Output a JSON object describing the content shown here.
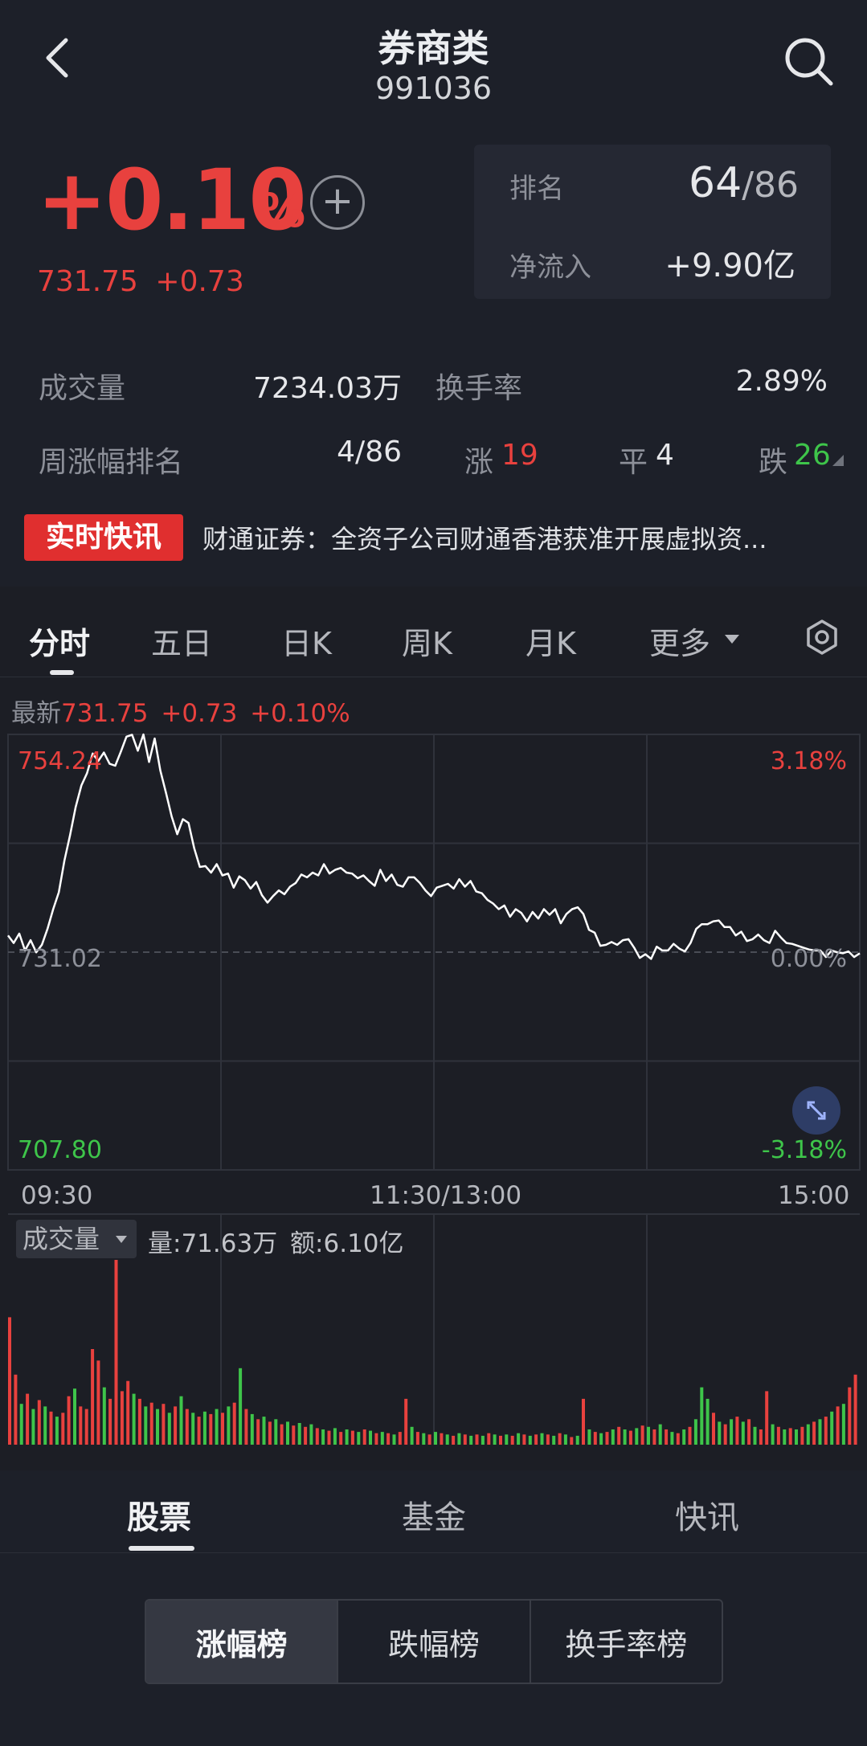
{
  "header": {
    "title": "券商类",
    "code": "991036"
  },
  "quote": {
    "change_pct": "+0.10",
    "pct_unit": "%",
    "add_symbol": "+",
    "price": "731.75",
    "change": "+0.73"
  },
  "rank": {
    "label": "排名",
    "value": "64",
    "total": "/86",
    "inflow_label": "净流入",
    "inflow_value": "+9.90亿"
  },
  "stats": {
    "volume_label": "成交量",
    "volume_value": "7234.03万",
    "turnover_label": "换手率",
    "turnover_value": "2.89%",
    "week_rank_label": "周涨幅排名",
    "week_rank_value": "4/86",
    "up_label": "涨",
    "up_count": "19",
    "flat_label": "平",
    "flat_count": "4",
    "down_label": "跌",
    "down_count": "26"
  },
  "news": {
    "badge": "实时快讯",
    "text": "财通证券：全资子公司财通香港获准开展虚拟资..."
  },
  "chart_tabs": [
    "分时",
    "五日",
    "日K",
    "周K",
    "月K",
    "更多"
  ],
  "latest": {
    "label": "最新",
    "price": "731.75",
    "change": "+0.73",
    "pct": "+0.10%"
  },
  "chart_data": {
    "type": "line",
    "title": "",
    "x_ticks": [
      "09:30",
      "11:30/13:00",
      "15:00"
    ],
    "y_left_labels": {
      "high": "754.24",
      "base": "731.02",
      "low": "707.80"
    },
    "y_right_labels": {
      "high": "3.18%",
      "base": "0.00%",
      "low": "-3.18%"
    },
    "ylim": [
      707.8,
      754.24
    ],
    "baseline": 731.02,
    "series": [
      {
        "values": [
          732.8,
          732.0,
          733.0,
          731.2,
          732.3,
          731.0,
          731.8,
          733.5,
          735.6,
          737.4,
          740.8,
          743.5,
          746.5,
          748.8,
          750.1,
          752.2,
          751.4,
          752.3,
          751.1,
          750.9,
          752.4,
          754.0,
          754.2,
          752.5,
          754.24,
          751.3,
          753.8,
          750.4,
          748.0,
          745.5,
          743.6,
          745.2,
          744.8,
          742.1,
          740.1,
          740.2,
          739.5,
          740.4,
          739.2,
          739.4,
          737.9,
          739.1,
          738.7,
          737.8,
          738.5,
          737.1,
          736.3,
          737.0,
          737.6,
          737.2,
          738.0,
          738.4,
          739.3,
          739.0,
          739.5,
          739.2,
          740.4,
          739.4,
          739.8,
          740.0,
          739.5,
          739.4,
          738.9,
          739.2,
          738.6,
          738.1,
          739.8,
          738.6,
          739.3,
          738.2,
          738.0,
          739.0,
          739.0,
          738.4,
          737.6,
          737.0,
          737.9,
          738.1,
          738.3,
          737.8,
          738.8,
          738.0,
          738.6,
          737.5,
          737.3,
          736.6,
          736.2,
          735.6,
          736.0,
          734.8,
          735.6,
          735.2,
          734.3,
          735.3,
          734.6,
          735.6,
          735.0,
          735.6,
          734.1,
          735.1,
          735.6,
          735.8,
          735.1,
          733.4,
          733.1,
          731.7,
          731.8,
          732.1,
          731.8,
          732.3,
          732.4,
          731.5,
          730.4,
          730.8,
          730.3,
          731.6,
          731.2,
          731.2,
          731.9,
          731.4,
          731.1,
          732.0,
          733.5,
          734.0,
          734.0,
          734.3,
          734.4,
          733.7,
          733.7,
          732.8,
          733.2,
          732.2,
          732.4,
          732.9,
          732.3,
          732.0,
          733.3,
          732.6,
          732.0,
          731.9,
          731.7,
          731.5,
          731.3,
          731.2,
          731.2,
          730.5,
          731.2,
          731.0,
          730.9,
          731.1,
          730.5,
          730.9
        ]
      }
    ],
    "volume": {
      "label": "成交量",
      "info": "量:71.63万 额:6.10亿",
      "up_color": "#e8413e",
      "down_color": "#3ec54a",
      "bars": [
        {
          "v": 100,
          "u": 1
        },
        {
          "v": 55,
          "u": 1
        },
        {
          "v": 32,
          "u": 0
        },
        {
          "v": 40,
          "u": 1
        },
        {
          "v": 28,
          "u": 0
        },
        {
          "v": 35,
          "u": 1
        },
        {
          "v": 30,
          "u": 0
        },
        {
          "v": 26,
          "u": 1
        },
        {
          "v": 22,
          "u": 0
        },
        {
          "v": 25,
          "u": 1
        },
        {
          "v": 38,
          "u": 1
        },
        {
          "v": 44,
          "u": 0
        },
        {
          "v": 30,
          "u": 1
        },
        {
          "v": 28,
          "u": 1
        },
        {
          "v": 75,
          "u": 1
        },
        {
          "v": 66,
          "u": 1
        },
        {
          "v": 45,
          "u": 0
        },
        {
          "v": 36,
          "u": 1
        },
        {
          "v": 145,
          "u": 1
        },
        {
          "v": 42,
          "u": 1
        },
        {
          "v": 50,
          "u": 1
        },
        {
          "v": 40,
          "u": 0
        },
        {
          "v": 36,
          "u": 1
        },
        {
          "v": 30,
          "u": 0
        },
        {
          "v": 33,
          "u": 1
        },
        {
          "v": 28,
          "u": 0
        },
        {
          "v": 32,
          "u": 1
        },
        {
          "v": 25,
          "u": 0
        },
        {
          "v": 30,
          "u": 1
        },
        {
          "v": 38,
          "u": 0
        },
        {
          "v": 28,
          "u": 1
        },
        {
          "v": 25,
          "u": 0
        },
        {
          "v": 22,
          "u": 1
        },
        {
          "v": 26,
          "u": 0
        },
        {
          "v": 24,
          "u": 1
        },
        {
          "v": 28,
          "u": 0
        },
        {
          "v": 25,
          "u": 1
        },
        {
          "v": 30,
          "u": 0
        },
        {
          "v": 33,
          "u": 1
        },
        {
          "v": 60,
          "u": 0
        },
        {
          "v": 28,
          "u": 1
        },
        {
          "v": 24,
          "u": 0
        },
        {
          "v": 20,
          "u": 1
        },
        {
          "v": 22,
          "u": 0
        },
        {
          "v": 18,
          "u": 1
        },
        {
          "v": 20,
          "u": 0
        },
        {
          "v": 16,
          "u": 1
        },
        {
          "v": 18,
          "u": 0
        },
        {
          "v": 15,
          "u": 1
        },
        {
          "v": 17,
          "u": 0
        },
        {
          "v": 14,
          "u": 1
        },
        {
          "v": 16,
          "u": 0
        },
        {
          "v": 13,
          "u": 1
        },
        {
          "v": 12,
          "u": 0
        },
        {
          "v": 11,
          "u": 1
        },
        {
          "v": 13,
          "u": 0
        },
        {
          "v": 10,
          "u": 1
        },
        {
          "v": 12,
          "u": 0
        },
        {
          "v": 11,
          "u": 1
        },
        {
          "v": 10,
          "u": 0
        },
        {
          "v": 12,
          "u": 1
        },
        {
          "v": 11,
          "u": 0
        },
        {
          "v": 9,
          "u": 1
        },
        {
          "v": 10,
          "u": 0
        },
        {
          "v": 9,
          "u": 1
        },
        {
          "v": 8,
          "u": 0
        },
        {
          "v": 10,
          "u": 1
        },
        {
          "v": 36,
          "u": 1
        },
        {
          "v": 14,
          "u": 0
        },
        {
          "v": 10,
          "u": 1
        },
        {
          "v": 9,
          "u": 0
        },
        {
          "v": 8,
          "u": 1
        },
        {
          "v": 10,
          "u": 0
        },
        {
          "v": 9,
          "u": 1
        },
        {
          "v": 8,
          "u": 0
        },
        {
          "v": 7,
          "u": 1
        },
        {
          "v": 9,
          "u": 0
        },
        {
          "v": 8,
          "u": 1
        },
        {
          "v": 7,
          "u": 0
        },
        {
          "v": 8,
          "u": 1
        },
        {
          "v": 7,
          "u": 0
        },
        {
          "v": 9,
          "u": 1
        },
        {
          "v": 8,
          "u": 0
        },
        {
          "v": 7,
          "u": 1
        },
        {
          "v": 8,
          "u": 0
        },
        {
          "v": 7,
          "u": 1
        },
        {
          "v": 9,
          "u": 0
        },
        {
          "v": 8,
          "u": 1
        },
        {
          "v": 7,
          "u": 0
        },
        {
          "v": 8,
          "u": 1
        },
        {
          "v": 9,
          "u": 0
        },
        {
          "v": 8,
          "u": 1
        },
        {
          "v": 7,
          "u": 0
        },
        {
          "v": 9,
          "u": 1
        },
        {
          "v": 8,
          "u": 0
        },
        {
          "v": 6,
          "u": 1
        },
        {
          "v": 7,
          "u": 0
        },
        {
          "v": 36,
          "u": 1
        },
        {
          "v": 12,
          "u": 0
        },
        {
          "v": 10,
          "u": 1
        },
        {
          "v": 9,
          "u": 0
        },
        {
          "v": 10,
          "u": 1
        },
        {
          "v": 12,
          "u": 0
        },
        {
          "v": 14,
          "u": 1
        },
        {
          "v": 12,
          "u": 0
        },
        {
          "v": 11,
          "u": 1
        },
        {
          "v": 13,
          "u": 0
        },
        {
          "v": 15,
          "u": 1
        },
        {
          "v": 14,
          "u": 0
        },
        {
          "v": 12,
          "u": 1
        },
        {
          "v": 16,
          "u": 0
        },
        {
          "v": 12,
          "u": 1
        },
        {
          "v": 10,
          "u": 0
        },
        {
          "v": 9,
          "u": 1
        },
        {
          "v": 12,
          "u": 0
        },
        {
          "v": 14,
          "u": 1
        },
        {
          "v": 20,
          "u": 0
        },
        {
          "v": 45,
          "u": 0
        },
        {
          "v": 36,
          "u": 0
        },
        {
          "v": 25,
          "u": 1
        },
        {
          "v": 18,
          "u": 0
        },
        {
          "v": 16,
          "u": 1
        },
        {
          "v": 20,
          "u": 0
        },
        {
          "v": 22,
          "u": 1
        },
        {
          "v": 18,
          "u": 0
        },
        {
          "v": 20,
          "u": 1
        },
        {
          "v": 14,
          "u": 0
        },
        {
          "v": 12,
          "u": 1
        },
        {
          "v": 42,
          "u": 1
        },
        {
          "v": 16,
          "u": 0
        },
        {
          "v": 14,
          "u": 1
        },
        {
          "v": 12,
          "u": 0
        },
        {
          "v": 13,
          "u": 1
        },
        {
          "v": 12,
          "u": 0
        },
        {
          "v": 14,
          "u": 1
        },
        {
          "v": 16,
          "u": 0
        },
        {
          "v": 18,
          "u": 1
        },
        {
          "v": 20,
          "u": 0
        },
        {
          "v": 22,
          "u": 1
        },
        {
          "v": 26,
          "u": 0
        },
        {
          "v": 30,
          "u": 1
        },
        {
          "v": 32,
          "u": 0
        },
        {
          "v": 45,
          "u": 1
        },
        {
          "v": 55,
          "u": 1
        }
      ]
    }
  },
  "bottom_tabs": [
    "股票",
    "基金",
    "快讯"
  ],
  "segments": [
    "涨幅榜",
    "跌幅榜",
    "换手率榜"
  ],
  "colors": {
    "background": "#1d2029",
    "up": "#e8413e",
    "down": "#3ec54a",
    "line": "#ffffff"
  }
}
